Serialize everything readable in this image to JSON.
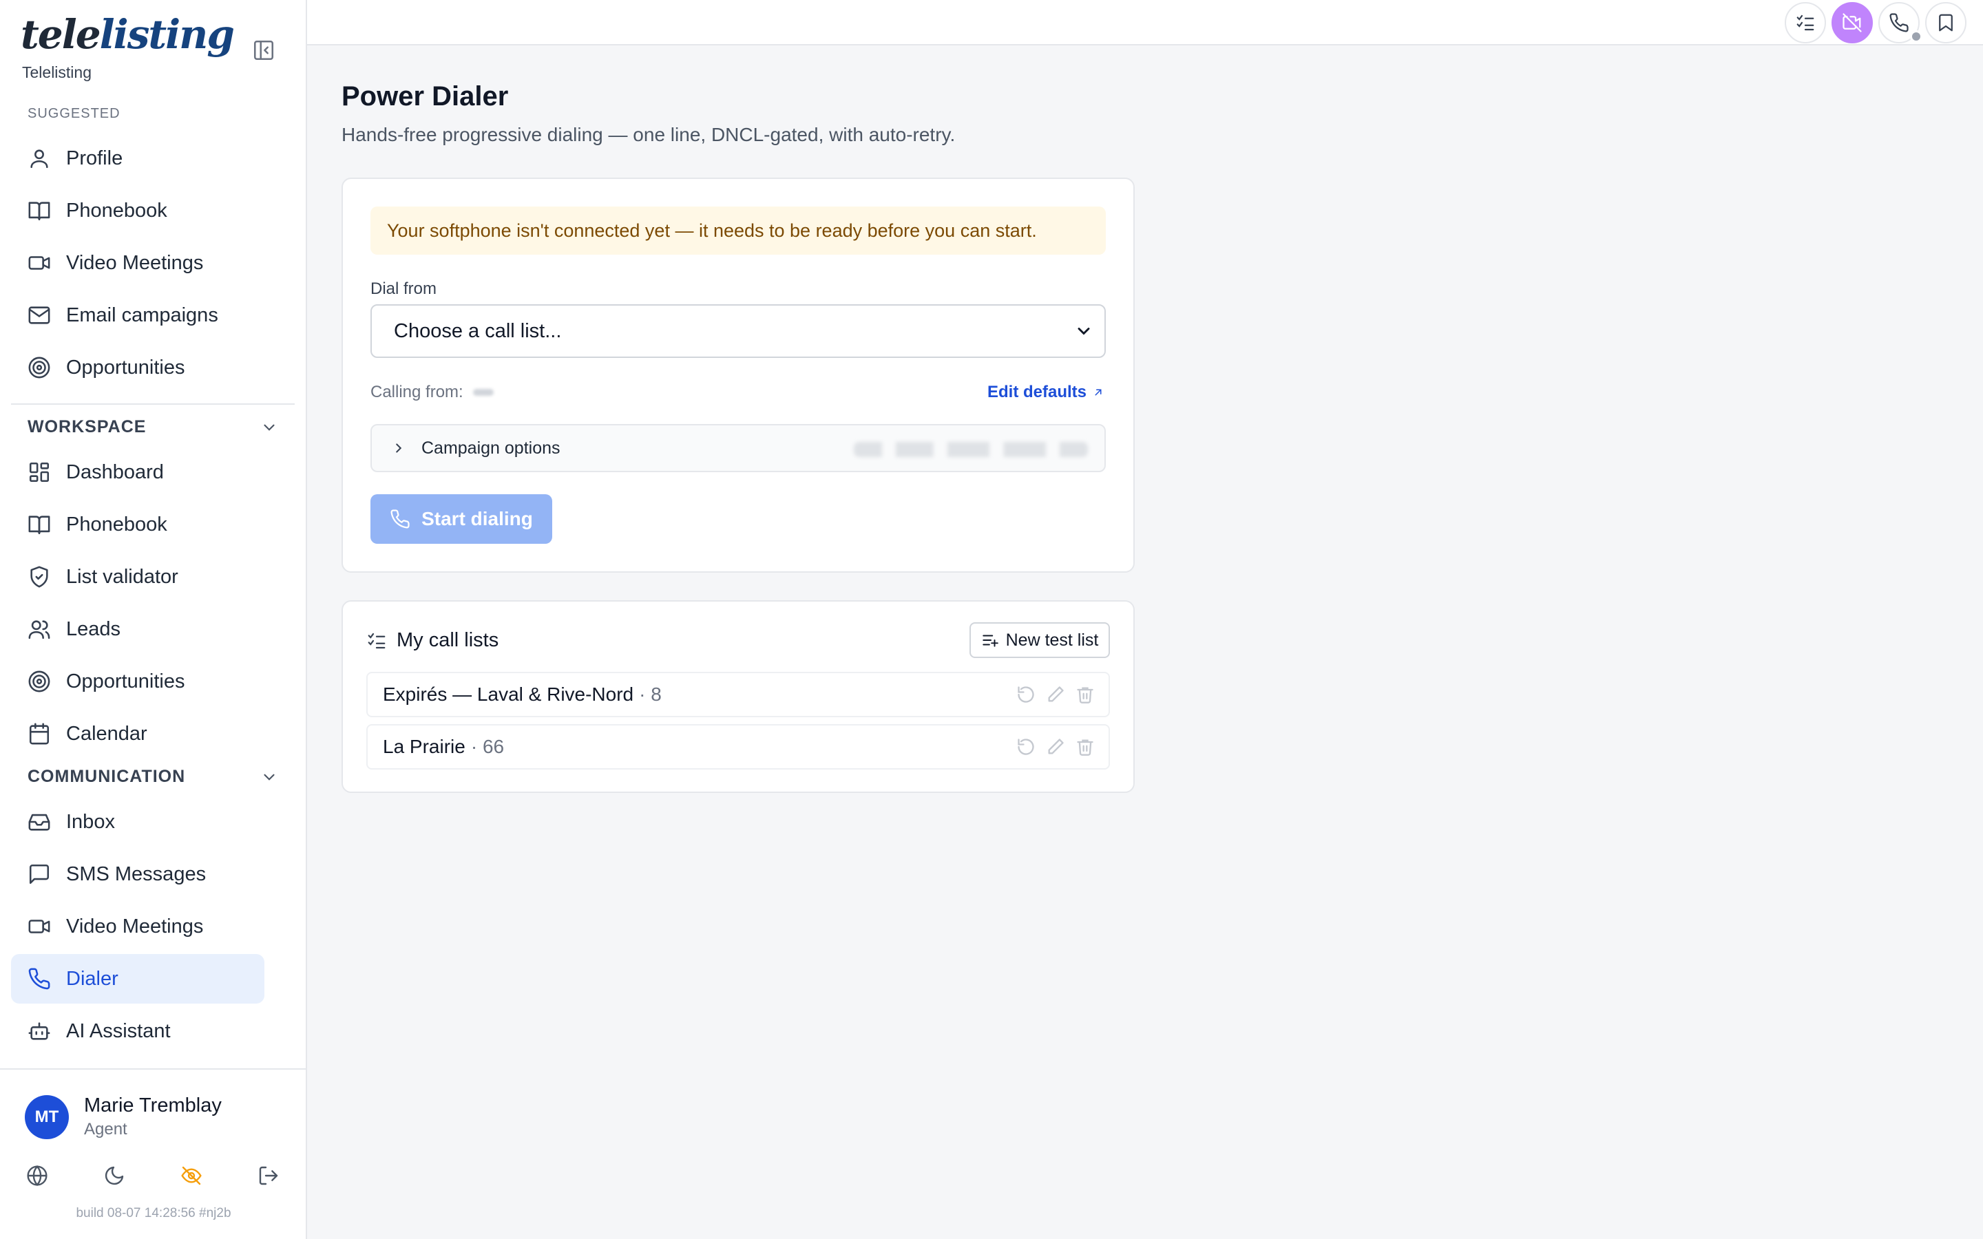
{
  "app": {
    "logo_tele": "tele",
    "logo_listing": "listing",
    "org_name": "Telelisting",
    "brand_color": "#16437e",
    "accent_color": "#1d4ed8"
  },
  "sidebar": {
    "suggested_label": "SUGGESTED",
    "suggested": [
      {
        "label": "Profile",
        "icon": "user-icon"
      },
      {
        "label": "Phonebook",
        "icon": "book-icon"
      },
      {
        "label": "Video Meetings",
        "icon": "video-icon"
      },
      {
        "label": "Email campaigns",
        "icon": "mail-icon"
      },
      {
        "label": "Opportunities",
        "icon": "target-icon"
      }
    ],
    "workspace_label": "WORKSPACE",
    "workspace": [
      {
        "label": "Dashboard",
        "icon": "dashboard-icon"
      },
      {
        "label": "Phonebook",
        "icon": "book-icon"
      },
      {
        "label": "List validator",
        "icon": "shield-check-icon"
      },
      {
        "label": "Leads",
        "icon": "users-icon"
      },
      {
        "label": "Opportunities",
        "icon": "target-icon"
      },
      {
        "label": "Calendar",
        "icon": "calendar-icon"
      }
    ],
    "communication_label": "COMMUNICATION",
    "communication": [
      {
        "label": "Inbox",
        "icon": "inbox-icon"
      },
      {
        "label": "SMS Messages",
        "icon": "message-icon"
      },
      {
        "label": "Video Meetings",
        "icon": "video-icon"
      },
      {
        "label": "Dialer",
        "icon": "phone-icon",
        "active": true
      },
      {
        "label": "AI Assistant",
        "icon": "bot-icon"
      }
    ],
    "user": {
      "initials": "MT",
      "name": "Marie Tremblay",
      "role": "Agent"
    },
    "build": "build 08-07 14:28:56 #nj2b"
  },
  "topbar": {
    "buttons": [
      "checklist-icon",
      "video-off-icon",
      "phone-icon",
      "bookmark-icon"
    ],
    "active_color": "#c084fc"
  },
  "main": {
    "title": "Power Dialer",
    "subtitle": "Hands-free progressive dialing — one line, DNCL-gated, with auto-retry.",
    "alert": "Your softphone isn't connected yet — it needs to be ready before you can start.",
    "dial_from_label": "Dial from",
    "dial_from_value": "Choose a call list...",
    "calling_from_label": "Calling from:",
    "edit_defaults": "Edit defaults",
    "campaign_options": "Campaign options",
    "start_button": "Start dialing"
  },
  "call_lists": {
    "title": "My call lists",
    "new_button": "New test list",
    "rows": [
      {
        "name": "Expirés — Laval & Rive-Nord",
        "count": "· 8"
      },
      {
        "name": "La Prairie",
        "count": "· 66"
      }
    ]
  }
}
